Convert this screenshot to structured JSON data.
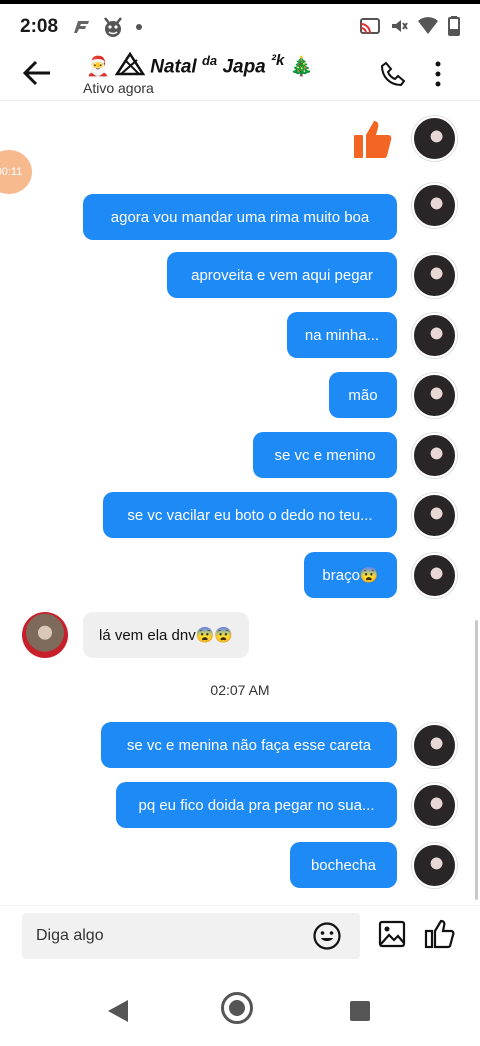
{
  "status_bar": {
    "time": "2:08",
    "icons_left": [
      "f-icon",
      "devil-face-icon",
      "dot-icon"
    ],
    "icons_right": [
      "cast-icon",
      "mute-icon",
      "wifi-icon",
      "battery-icon"
    ]
  },
  "header": {
    "title": "Natal",
    "title_sup": "da",
    "title_rest": "Japa",
    "title_sup2": "²k",
    "title_emoji_left": "🎅",
    "title_emoji_right": "🎄",
    "subtitle": "Ativo agora"
  },
  "float_badge": "00:11",
  "messages": [
    {
      "type": "out",
      "text": "agora vou mandar uma rima muito boa"
    },
    {
      "type": "out",
      "text": "aproveita e vem aqui pegar"
    },
    {
      "type": "out",
      "text": "na minha..."
    },
    {
      "type": "out",
      "text": "mão"
    },
    {
      "type": "out",
      "text": "se vc e menino"
    },
    {
      "type": "out",
      "text": "se vc vacilar eu boto o dedo no teu..."
    },
    {
      "type": "out",
      "text": "braço😨"
    },
    {
      "type": "in",
      "text": "lá vem ela dnv😨😨"
    },
    {
      "type": "out",
      "text": "se vc e menina não faça esse careta"
    },
    {
      "type": "out",
      "text": "pq eu fico doida pra pegar no sua..."
    },
    {
      "type": "out",
      "text": "bochecha"
    }
  ],
  "timestamp": "02:07 AM",
  "composer": {
    "placeholder": "Diga algo"
  },
  "colors": {
    "accent": "#1e8af5",
    "like": "#f26522",
    "incoming_bubble": "#efefef"
  }
}
